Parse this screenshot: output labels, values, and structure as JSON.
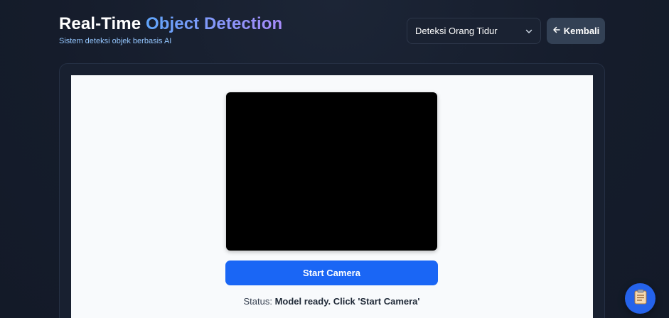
{
  "header": {
    "title_main": "Real-Time",
    "title_accent": "Object Detection",
    "subtitle": "Sistem deteksi objek berbasis AI"
  },
  "controls": {
    "model_select_value": "Deteksi Orang Tidur",
    "back_label": "Kembali"
  },
  "camera": {
    "start_label": "Start Camera",
    "status_label": "Status:",
    "status_value": "Model ready. Click 'Start Camera'"
  },
  "icons": {
    "select": "chevron-down-icon",
    "back": "arrow-left-icon",
    "fab": "clipboard-icon"
  },
  "colors": {
    "accent_gradient_start": "#60a5fa",
    "accent_gradient_end": "#a78bfa",
    "primary_button": "#1a66f5",
    "background": "#161e2e"
  }
}
